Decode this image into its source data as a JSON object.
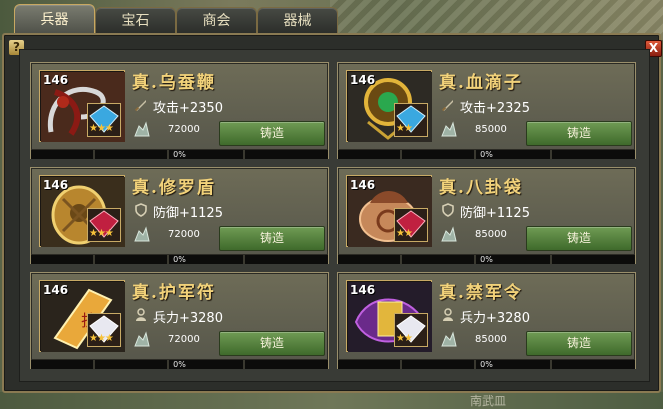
{
  "tabs": [
    {
      "label": "兵器",
      "active": true
    },
    {
      "label": "宝石",
      "active": false
    },
    {
      "label": "商会",
      "active": false
    },
    {
      "label": "器械",
      "active": false
    }
  ],
  "window": {
    "help_label": "?",
    "close_label": "X"
  },
  "bottom_text": "南武皿",
  "forge_label": "铸造",
  "items": [
    {
      "level": "146",
      "name": "真.乌蚕鞭",
      "stat_icon": "sword-icon",
      "stat": "攻击+2350",
      "cost": "72000",
      "progress_label": "0%",
      "progress": 0,
      "stars": "★★★"
    },
    {
      "level": "146",
      "name": "真.血滴子",
      "stat_icon": "sword-icon",
      "stat": "攻击+2325",
      "cost": "85000",
      "progress_label": "0%",
      "progress": 0,
      "stars": "★★"
    },
    {
      "level": "146",
      "name": "真.修罗盾",
      "stat_icon": "shield-icon",
      "stat": "防御+1125",
      "cost": "72000",
      "progress_label": "0%",
      "progress": 0,
      "stars": "★★★"
    },
    {
      "level": "146",
      "name": "真.八卦袋",
      "stat_icon": "shield-icon",
      "stat": "防御+1125",
      "cost": "85000",
      "progress_label": "0%",
      "progress": 0,
      "stars": "★★"
    },
    {
      "level": "146",
      "name": "真.护军符",
      "stat_icon": "soldier-icon",
      "stat": "兵力+3280",
      "cost": "72000",
      "progress_label": "0%",
      "progress": 0,
      "stars": "★★★"
    },
    {
      "level": "146",
      "name": "真.禁军令",
      "stat_icon": "soldier-icon",
      "stat": "兵力+3280",
      "cost": "85000",
      "progress_label": "0%",
      "progress": 0,
      "stars": "★★"
    }
  ],
  "colors": {
    "gem_red": "#c02040",
    "gem_blue": "#3aa8e0",
    "gem_white": "#e8e8f0",
    "forge_green": "#4f7d3a"
  }
}
